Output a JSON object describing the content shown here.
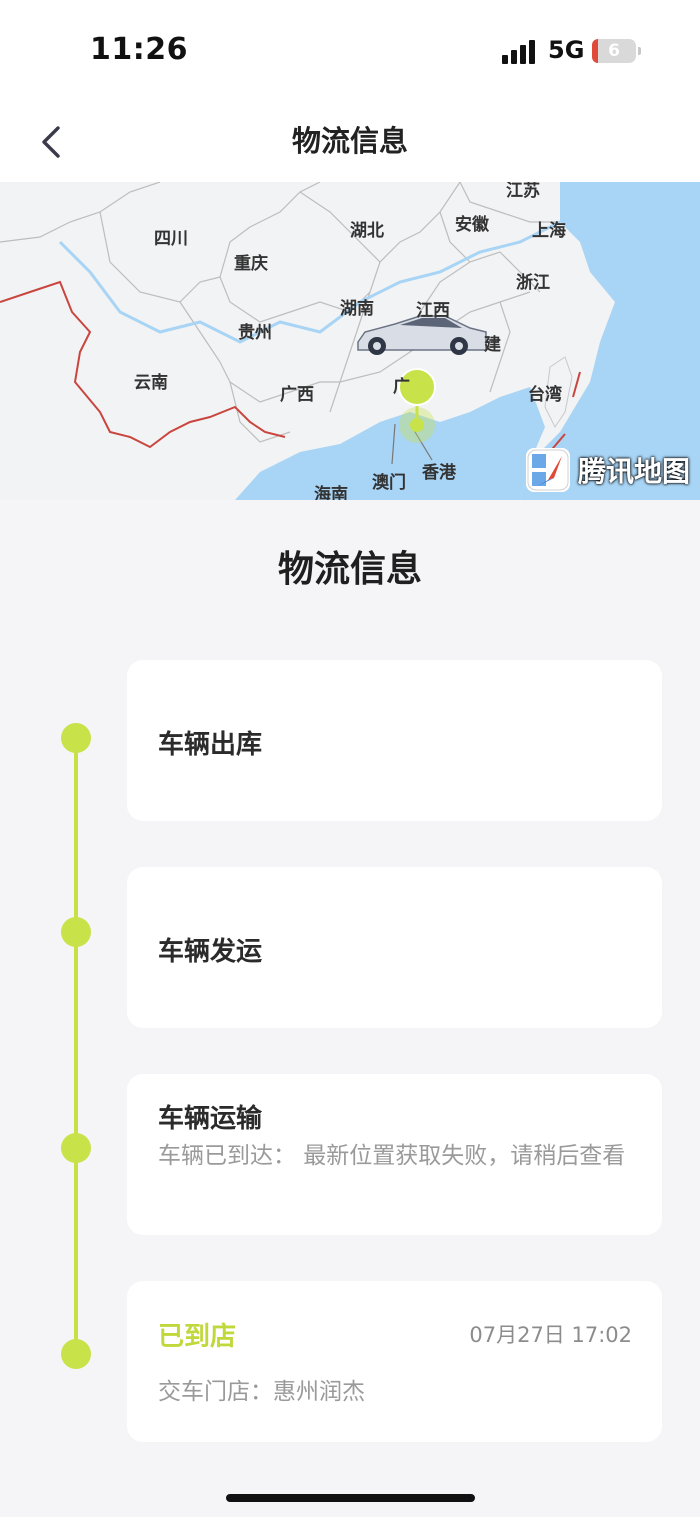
{
  "status_bar": {
    "time": "11:26",
    "network": "5G",
    "battery": "6"
  },
  "nav": {
    "title": "物流信息"
  },
  "map": {
    "labels": {
      "jiangsu": "江苏",
      "sichuan": "四川",
      "hubei": "湖北",
      "anhui": "安徽",
      "shanghai": "上海",
      "chongqing": "重庆",
      "zhejiang": "浙江",
      "hunan": "湖南",
      "jiangxi": "江西",
      "guizhou": "贵州",
      "fujian": "建",
      "yunnan": "云南",
      "guangxi": "广西",
      "guangdong": "广",
      "taiwan": "台湾",
      "macau": "澳门",
      "hongkong": "香港",
      "hainan": "海南"
    },
    "brand": "腾讯地图",
    "colors": {
      "sea": "#a8d4f5",
      "land": "#f2f3f4",
      "border": "#c9463f",
      "pin": "#c8e24a"
    }
  },
  "section": {
    "title": "物流信息"
  },
  "timeline": [
    {
      "title": "车辆出库"
    },
    {
      "title": "车辆发运"
    },
    {
      "title": "车辆运输",
      "desc": "车辆已到达： 最新位置获取失败，请稍后查看"
    },
    {
      "title": "已到店",
      "time": "07月27日 17:02",
      "desc": "交车门店：惠州润杰"
    }
  ],
  "accent_color": "#c8e24a"
}
